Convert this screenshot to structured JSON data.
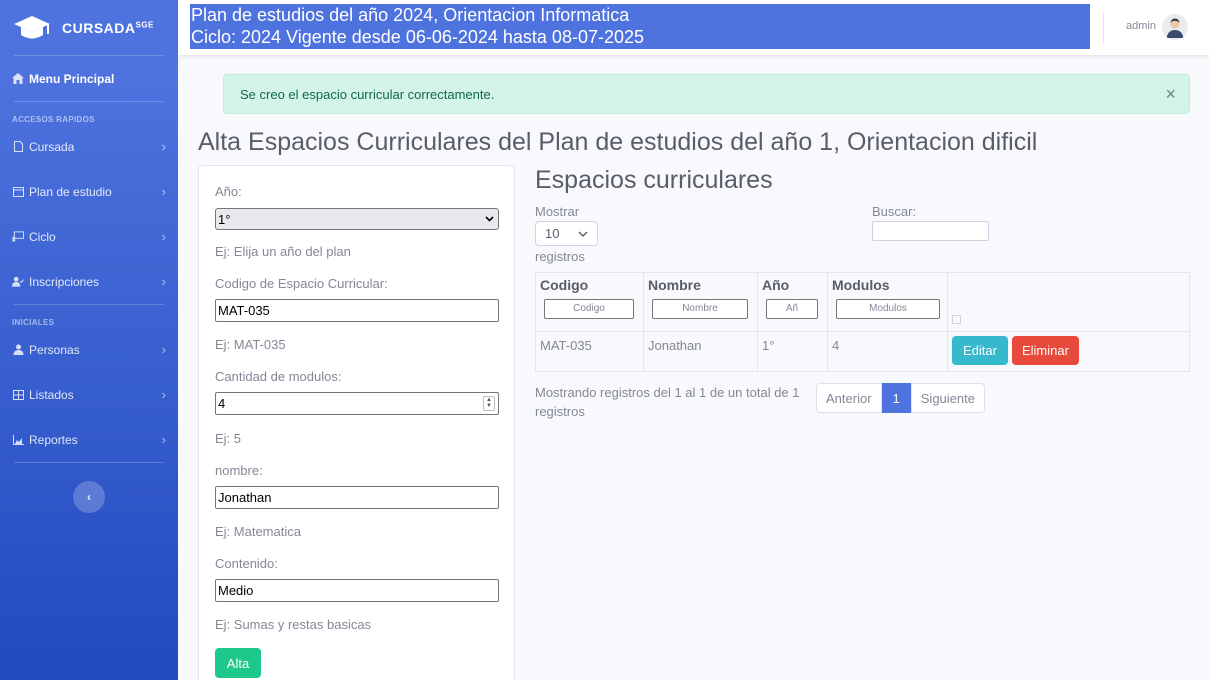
{
  "sidebar": {
    "brand": "CURSADA",
    "brand_sup": "SGE",
    "main_item": "Menu Principal",
    "heading_quick": "ACCESOS RAPIDOS",
    "quick_items": [
      "Cursada",
      "Plan de estudio",
      "Ciclo",
      "Inscripciones"
    ],
    "heading_initial": "INICIALES",
    "initial_items": [
      "Personas",
      "Listados",
      "Reportes"
    ],
    "toggle": "‹"
  },
  "topbar": {
    "plan_line1": "Plan de estudios del año 2024, Orientacion Informatica",
    "plan_line2": "Ciclo: 2024 Vigente desde 06-06-2024 hasta 08-07-2025",
    "user": "admin"
  },
  "alert": {
    "message": "Se creo el espacio curricular correctamente.",
    "close": "×"
  },
  "page_title": "Alta Espacios Curriculares del Plan de estudios del año 1, Orientacion dificil",
  "form": {
    "anio_label": "Año:",
    "anio_value": "1°",
    "anio_help": "Ej: Elija un año del plan",
    "codigo_label": "Codigo de Espacio Curricular:",
    "codigo_value": "MAT-035",
    "codigo_help": "Ej: MAT-035",
    "modulos_label": "Cantidad de modulos:",
    "modulos_value": "4",
    "modulos_help": "Ej: 5",
    "nombre_label": "nombre:",
    "nombre_value": "Jonathan",
    "nombre_help": "Ej: Matematica",
    "contenido_label": "Contenido:",
    "contenido_value": "Medio",
    "contenido_help": "Ej: Sumas y restas basicas",
    "submit": "Alta"
  },
  "list": {
    "title": "Espacios curriculares",
    "mostrar": "Mostrar",
    "page_size": "10",
    "registros": "registros",
    "buscar": "Buscar:",
    "columns": [
      "Codigo",
      "Nombre",
      "Año",
      "Modulos"
    ],
    "filters": [
      "Codigo",
      "Nombre",
      "Añ",
      "Modulos"
    ],
    "rows": [
      {
        "codigo": "MAT-035",
        "nombre": "Jonathan",
        "anio": "1°",
        "modulos": "4"
      }
    ],
    "edit": "Editar",
    "delete": "Eliminar",
    "info": "Mostrando registros del 1 al 1 de un total de 1 registros",
    "prev": "Anterior",
    "page": "1",
    "next": "Siguiente"
  }
}
